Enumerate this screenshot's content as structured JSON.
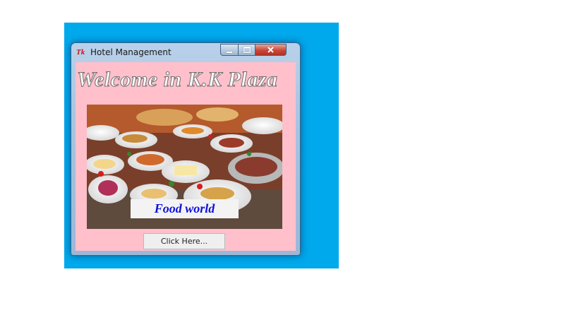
{
  "window": {
    "title": "Hotel Management",
    "icon_text": "Tk"
  },
  "heading": "Welcome in K.K Plaza",
  "image_caption": "Food world",
  "button_label": "Click Here...",
  "icons": [
    "tk-app-icon",
    "minimize-icon",
    "maximize-icon",
    "close-icon"
  ],
  "colors": {
    "desktop": "#00a8ec",
    "client_background": "#ffc0cb",
    "caption_text": "#1010e0",
    "close_button": "#c8483a"
  }
}
